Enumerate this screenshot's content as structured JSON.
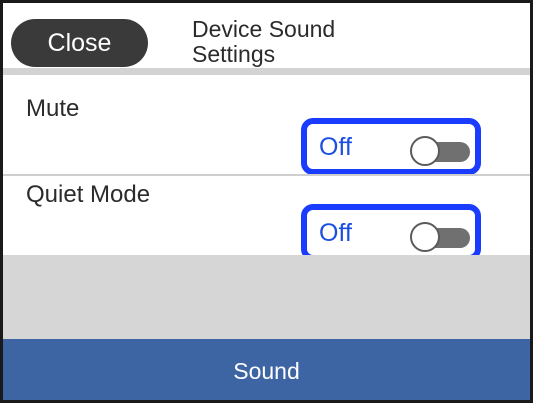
{
  "header": {
    "close_label": "Close",
    "title_line1": "Device Sound",
    "title_line2": "Settings"
  },
  "settings": [
    {
      "label": "Mute",
      "value": "Off",
      "enabled": false
    },
    {
      "label": "Quiet Mode",
      "value": "Off",
      "enabled": false
    }
  ],
  "footer": {
    "label": "Sound"
  },
  "colors": {
    "accent_border": "#1a3cff",
    "value_text": "#1b4fe0",
    "footer_bg": "#3e65a3",
    "close_bg": "#3a3a3a"
  },
  "icons": {
    "toggle": "toggle-switch-off-icon"
  }
}
